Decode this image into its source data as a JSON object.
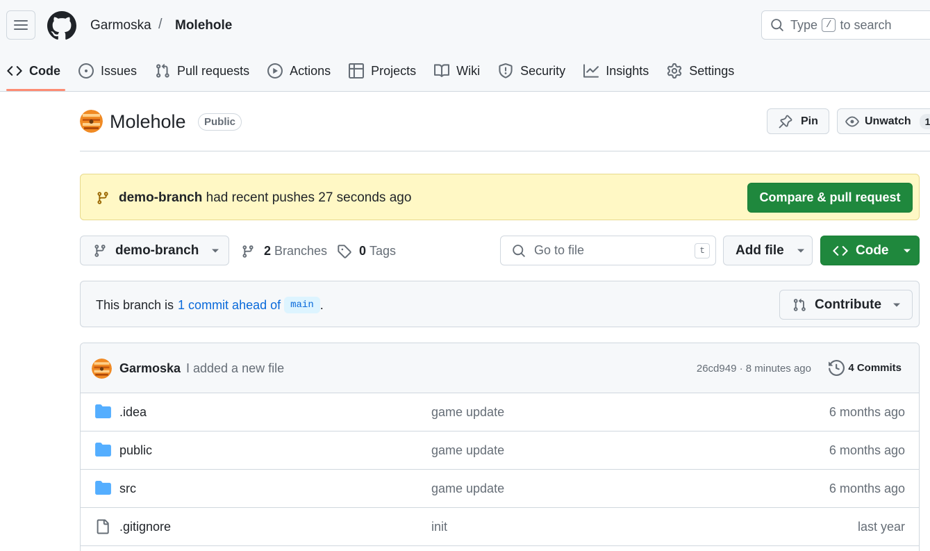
{
  "header": {
    "owner": "Garmoska",
    "separator": "/",
    "repo": "Molehole",
    "search": {
      "prefix": "Type",
      "key": "/",
      "suffix": "to search"
    }
  },
  "nav": {
    "tabs": [
      {
        "label": "Code",
        "icon": "code-icon",
        "active": true
      },
      {
        "label": "Issues",
        "icon": "issue-icon"
      },
      {
        "label": "Pull requests",
        "icon": "pull-request-icon"
      },
      {
        "label": "Actions",
        "icon": "play-icon"
      },
      {
        "label": "Projects",
        "icon": "table-icon"
      },
      {
        "label": "Wiki",
        "icon": "book-icon"
      },
      {
        "label": "Security",
        "icon": "shield-icon"
      },
      {
        "label": "Insights",
        "icon": "graph-icon"
      },
      {
        "label": "Settings",
        "icon": "gear-icon"
      }
    ]
  },
  "repo_head": {
    "title": "Molehole",
    "visibility": "Public",
    "pin_label": "Pin",
    "unwatch_label": "Unwatch",
    "watch_count": "1"
  },
  "banner": {
    "branch": "demo-branch",
    "message": "had recent pushes 27 seconds ago",
    "compare_label": "Compare & pull request"
  },
  "filenav": {
    "branch": "demo-branch",
    "branches_count": "2",
    "branches_label": "Branches",
    "tags_count": "0",
    "tags_label": "Tags",
    "goto_placeholder": "Go to file",
    "goto_key": "t",
    "add_file_label": "Add file",
    "code_label": "Code"
  },
  "ahead": {
    "prefix": "This branch is",
    "link": "1 commit ahead of",
    "base": "main",
    "suffix": ".",
    "contribute_label": "Contribute"
  },
  "latest_commit": {
    "author": "Garmoska",
    "message": "I added a new file",
    "sha_time": "26cd949 · 8 minutes ago",
    "commits_label": "4 Commits"
  },
  "files": [
    {
      "name": ".idea",
      "type": "folder",
      "message": "game update",
      "age": "6 months ago"
    },
    {
      "name": "public",
      "type": "folder",
      "message": "game update",
      "age": "6 months ago"
    },
    {
      "name": "src",
      "type": "folder",
      "message": "game update",
      "age": "6 months ago"
    },
    {
      "name": ".gitignore",
      "type": "file",
      "message": "init",
      "age": "last year"
    }
  ],
  "colors": {
    "primary_green": "#1f883d",
    "link_blue": "#0969da",
    "tab_underline": "#fd8c73",
    "banner_bg": "#fff8c5",
    "folder_blue": "#54aeff"
  }
}
